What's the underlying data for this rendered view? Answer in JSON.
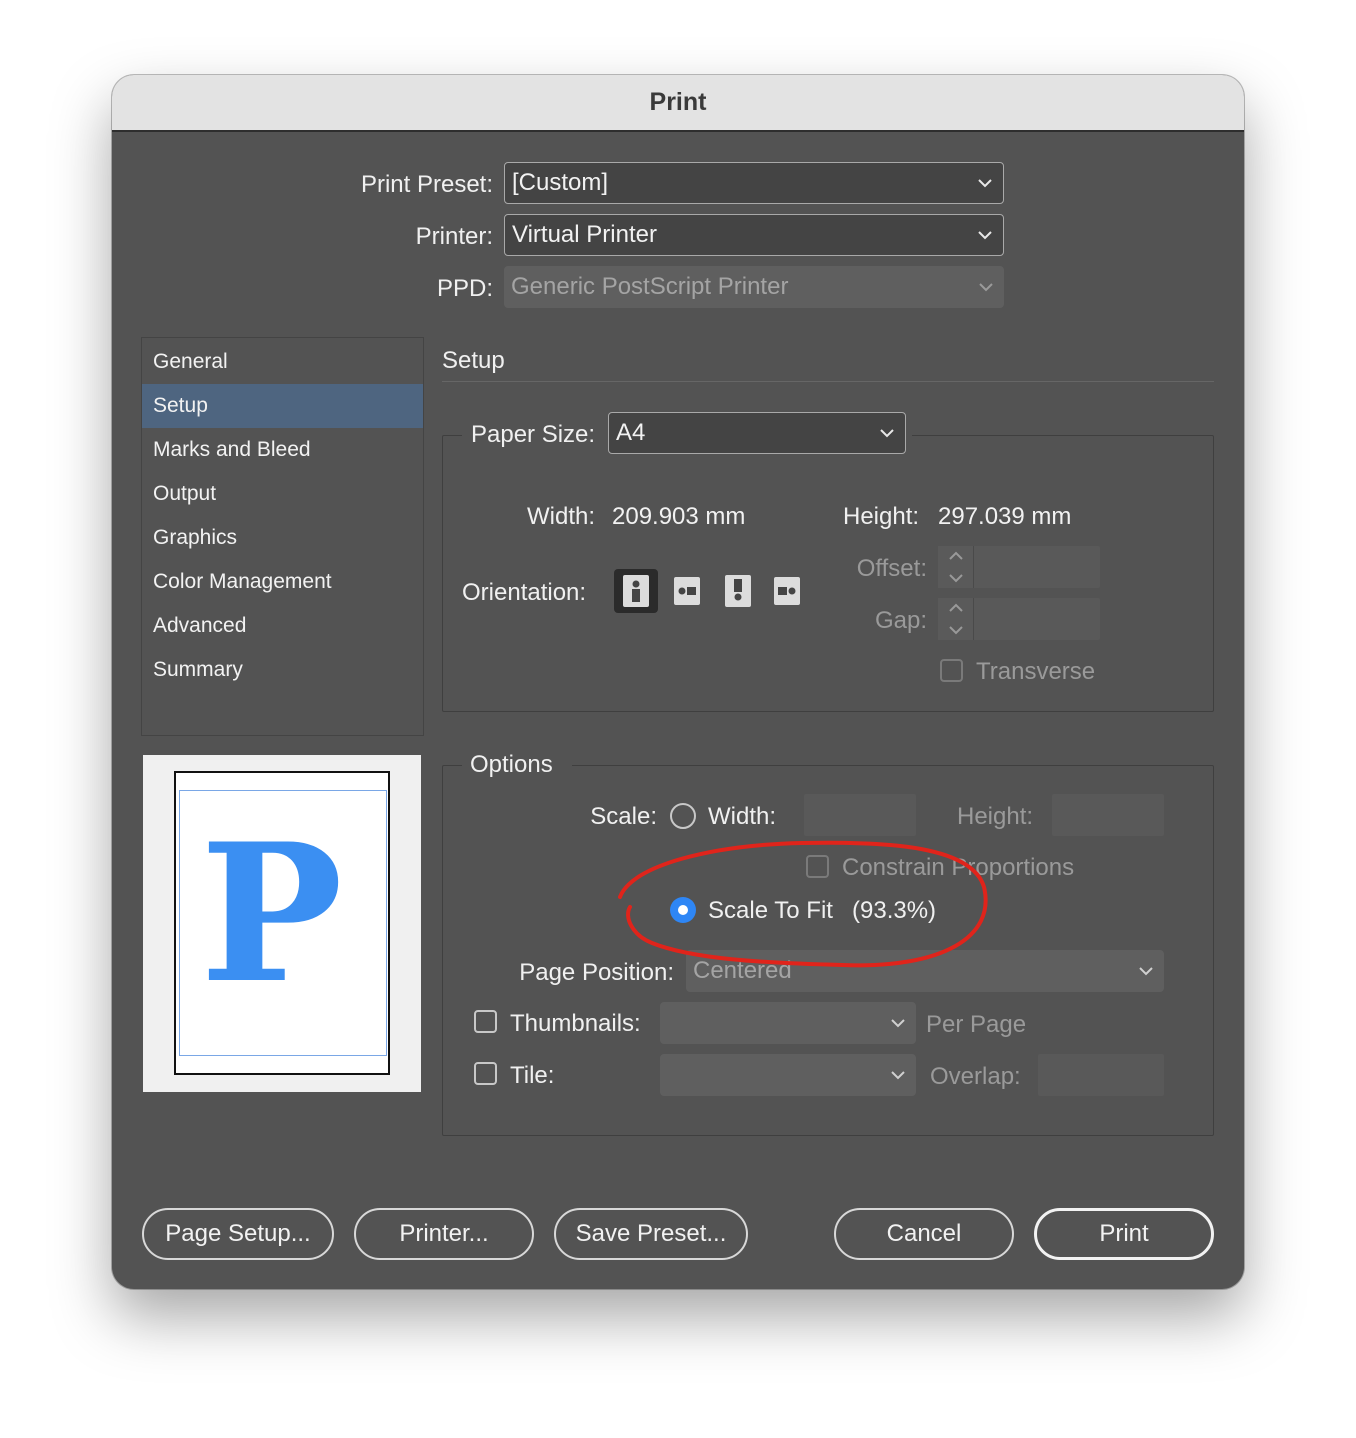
{
  "window": {
    "title": "Print"
  },
  "header": {
    "preset_label": "Print Preset:",
    "preset_value": "[Custom]",
    "printer_label": "Printer:",
    "printer_value": "Virtual Printer",
    "ppd_label": "PPD:",
    "ppd_value": "Generic PostScript Printer"
  },
  "sidebar": {
    "items": [
      {
        "label": "General"
      },
      {
        "label": "Setup",
        "selected": true
      },
      {
        "label": "Marks and Bleed"
      },
      {
        "label": "Output"
      },
      {
        "label": "Graphics"
      },
      {
        "label": "Color Management"
      },
      {
        "label": "Advanced"
      },
      {
        "label": "Summary"
      }
    ]
  },
  "preview": {
    "glyph": "P",
    "color": "#3b8ff2"
  },
  "setup": {
    "title": "Setup",
    "paper_size_label": "Paper Size:",
    "paper_size_value": "A4",
    "width_label": "Width:",
    "width_value": "209.903 mm",
    "height_label": "Height:",
    "height_value": "297.039 mm",
    "orientation_label": "Orientation:",
    "orientation_icons": [
      "portrait-icon",
      "landscape-icon",
      "reverse-portrait-icon",
      "reverse-landscape-icon"
    ],
    "offset_label": "Offset:",
    "gap_label": "Gap:",
    "transverse_label": "Transverse"
  },
  "options": {
    "title": "Options",
    "scale_label": "Scale:",
    "width_label": "Width:",
    "height_label": "Height:",
    "constrain_label": "Constrain Proportions",
    "scale_to_fit_label": "Scale To Fit",
    "scale_to_fit_value": "(93.3%)",
    "page_position_label": "Page Position:",
    "page_position_value": "Centered",
    "thumbnails_label": "Thumbnails:",
    "per_page_label": "Per Page",
    "tile_label": "Tile:",
    "overlap_label": "Overlap:"
  },
  "buttons": {
    "page_setup": "Page Setup...",
    "printer": "Printer...",
    "save_preset": "Save Preset...",
    "cancel": "Cancel",
    "print": "Print"
  },
  "colors": {
    "accent": "#2e86f5",
    "selection": "#4e6580",
    "annotation": "#e0241b",
    "dialog_bg": "#535353"
  }
}
